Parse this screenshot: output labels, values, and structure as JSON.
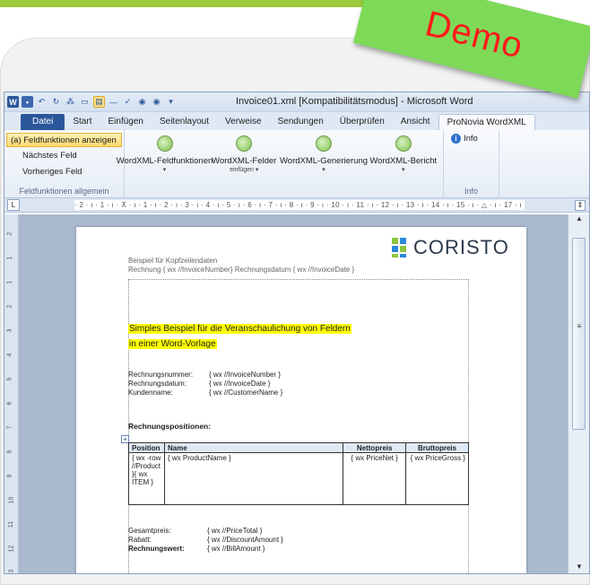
{
  "banner": {
    "text": "Demo"
  },
  "window": {
    "title": "Invoice01.xml [Kompatibilitätsmodus] - Microsoft Word",
    "qat": {
      "word_icon": "W",
      "undo": "↶",
      "redo": "↻",
      "dropdown": "▾"
    }
  },
  "tabs": [
    "Datei",
    "Start",
    "Einfügen",
    "Seitenlayout",
    "Verweise",
    "Sendungen",
    "Überprüfen",
    "Ansicht",
    "ProNovia WordXML"
  ],
  "ribbon": {
    "group1": {
      "show_fields": "(a) Feldfunktionen anzeigen",
      "next_field": "Nächstes Feld",
      "prev_field": "Vorheriges Feld",
      "label": "Feldfunktionen allgemein"
    },
    "buttons": [
      {
        "label": "WordXML-Feldfunktionen",
        "sub": "▾"
      },
      {
        "label": "WordXML-Felder",
        "sub": "einfügen ▾"
      },
      {
        "label": "WordXML-Generierung",
        "sub": "▾"
      },
      {
        "label": "WordXML-Bericht",
        "sub": "▾"
      }
    ],
    "info": {
      "button": "Info",
      "label": "Info"
    }
  },
  "ruler": {
    "corner": "L",
    "scale": "· 2 · ı · 1 · ı · ⊼ · ı · 1 · ı · 2 · ı · 3 · ı · 4 · ı · 5 · ı · 6 · ı · 7 · ı · 8 · ı · 9 · ı · 10 · ı · 11 · ı · 12 · ı · 13 · ı · 14 · ı · 15 · ı · △ · ı · 17 · ı · 18 ·"
  },
  "document": {
    "header_line1": "Beispiel für Kopfzeilendaten",
    "header_line2": "Rechnung {  wx //InvoiceNumber} Rechnungsdatum { wx //InvoiceDate }",
    "logo_text": "CORISTO",
    "title_line1": "Simples Beispiel für die Veranschaulichung von Feldern",
    "title_line2": "in einer Word-Vorlage",
    "fields": [
      {
        "k": "Rechnungsnummer:",
        "v": "{ wx //InvoiceNumber }"
      },
      {
        "k": "Rechnungsdatum:",
        "v": "{ wx //InvoiceDate }"
      },
      {
        "k": "Kundenname:",
        "v": "{ wx //CustomerName }"
      }
    ],
    "positions_heading": "Rechnungspositionen:",
    "table": {
      "headers": [
        "Position",
        "Name",
        "Nettopreis",
        "Bruttopreis"
      ],
      "row": [
        "{ wx -row //Product }{ wx ITEM }",
        "{ wx  ProductName }",
        "{ wx PriceNet }",
        "{ wx PriceGross }"
      ]
    },
    "totals": [
      {
        "k": "Gesamtpreis:",
        "v": "{ wx //PriceTotal }"
      },
      {
        "k": "Rabatt:",
        "v": "{ wx //DiscountAmount }"
      },
      {
        "k": "Rechnungswert:",
        "v": "{ wx //BillAmount }"
      }
    ]
  },
  "vruler_marks": [
    "2",
    "1",
    "1",
    "2",
    "3",
    "4",
    "5",
    "6",
    "7",
    "8",
    "9",
    "10",
    "11",
    "12",
    "13"
  ],
  "colors": {
    "word_blue": "#2b579a",
    "banner_green": "#7ed957",
    "banner_text": "#ff1a1a",
    "highlight": "#ffff00"
  }
}
